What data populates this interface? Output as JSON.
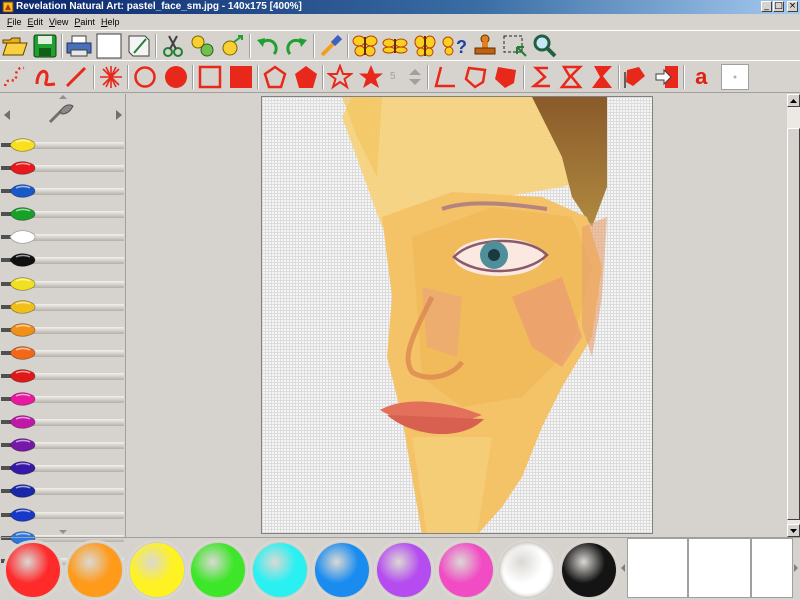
{
  "window": {
    "title": "Revelation Natural Art: pastel_face_sm.jpg - 140x175 [400%]",
    "minimize": "_",
    "maximize": "□",
    "close": "×"
  },
  "menu": {
    "items": [
      {
        "label": "File",
        "key": "F",
        "rest": "ile"
      },
      {
        "label": "Edit",
        "key": "E",
        "rest": "dit"
      },
      {
        "label": "View",
        "key": "V",
        "rest": "iew"
      },
      {
        "label": "Paint",
        "key": "P",
        "rest": "aint"
      },
      {
        "label": "Help",
        "key": "H",
        "rest": "elp"
      }
    ]
  },
  "toolbar": {
    "brush_size": "5"
  },
  "text_tool": {
    "label": "a"
  },
  "color_tubes": [
    "#f8e01c",
    "#e8181c",
    "#1858c8",
    "#18a028",
    "#ffffff",
    "#101010",
    "#f0e020",
    "#f0c018",
    "#f09018",
    "#f06818",
    "#e01818",
    "#e818a0",
    "#c018a8",
    "#7818a8",
    "#3818a8",
    "#1828a8",
    "#1838c8",
    "#2878e0",
    "#30a8e8"
  ],
  "paints": [
    {
      "name": "red",
      "color": "#ff2a2a"
    },
    {
      "name": "orange",
      "color": "#ff9a1a"
    },
    {
      "name": "yellow",
      "color": "#fff222"
    },
    {
      "name": "green",
      "color": "#3ee62a"
    },
    {
      "name": "cyan",
      "color": "#2af0f2"
    },
    {
      "name": "blue",
      "color": "#1a8cf0"
    },
    {
      "name": "violet",
      "color": "#b44cf0"
    },
    {
      "name": "pink",
      "color": "#f24cc4"
    },
    {
      "name": "white",
      "color": "#ffffff"
    },
    {
      "name": "black",
      "color": "#141414"
    }
  ],
  "accent": "#e8281a"
}
